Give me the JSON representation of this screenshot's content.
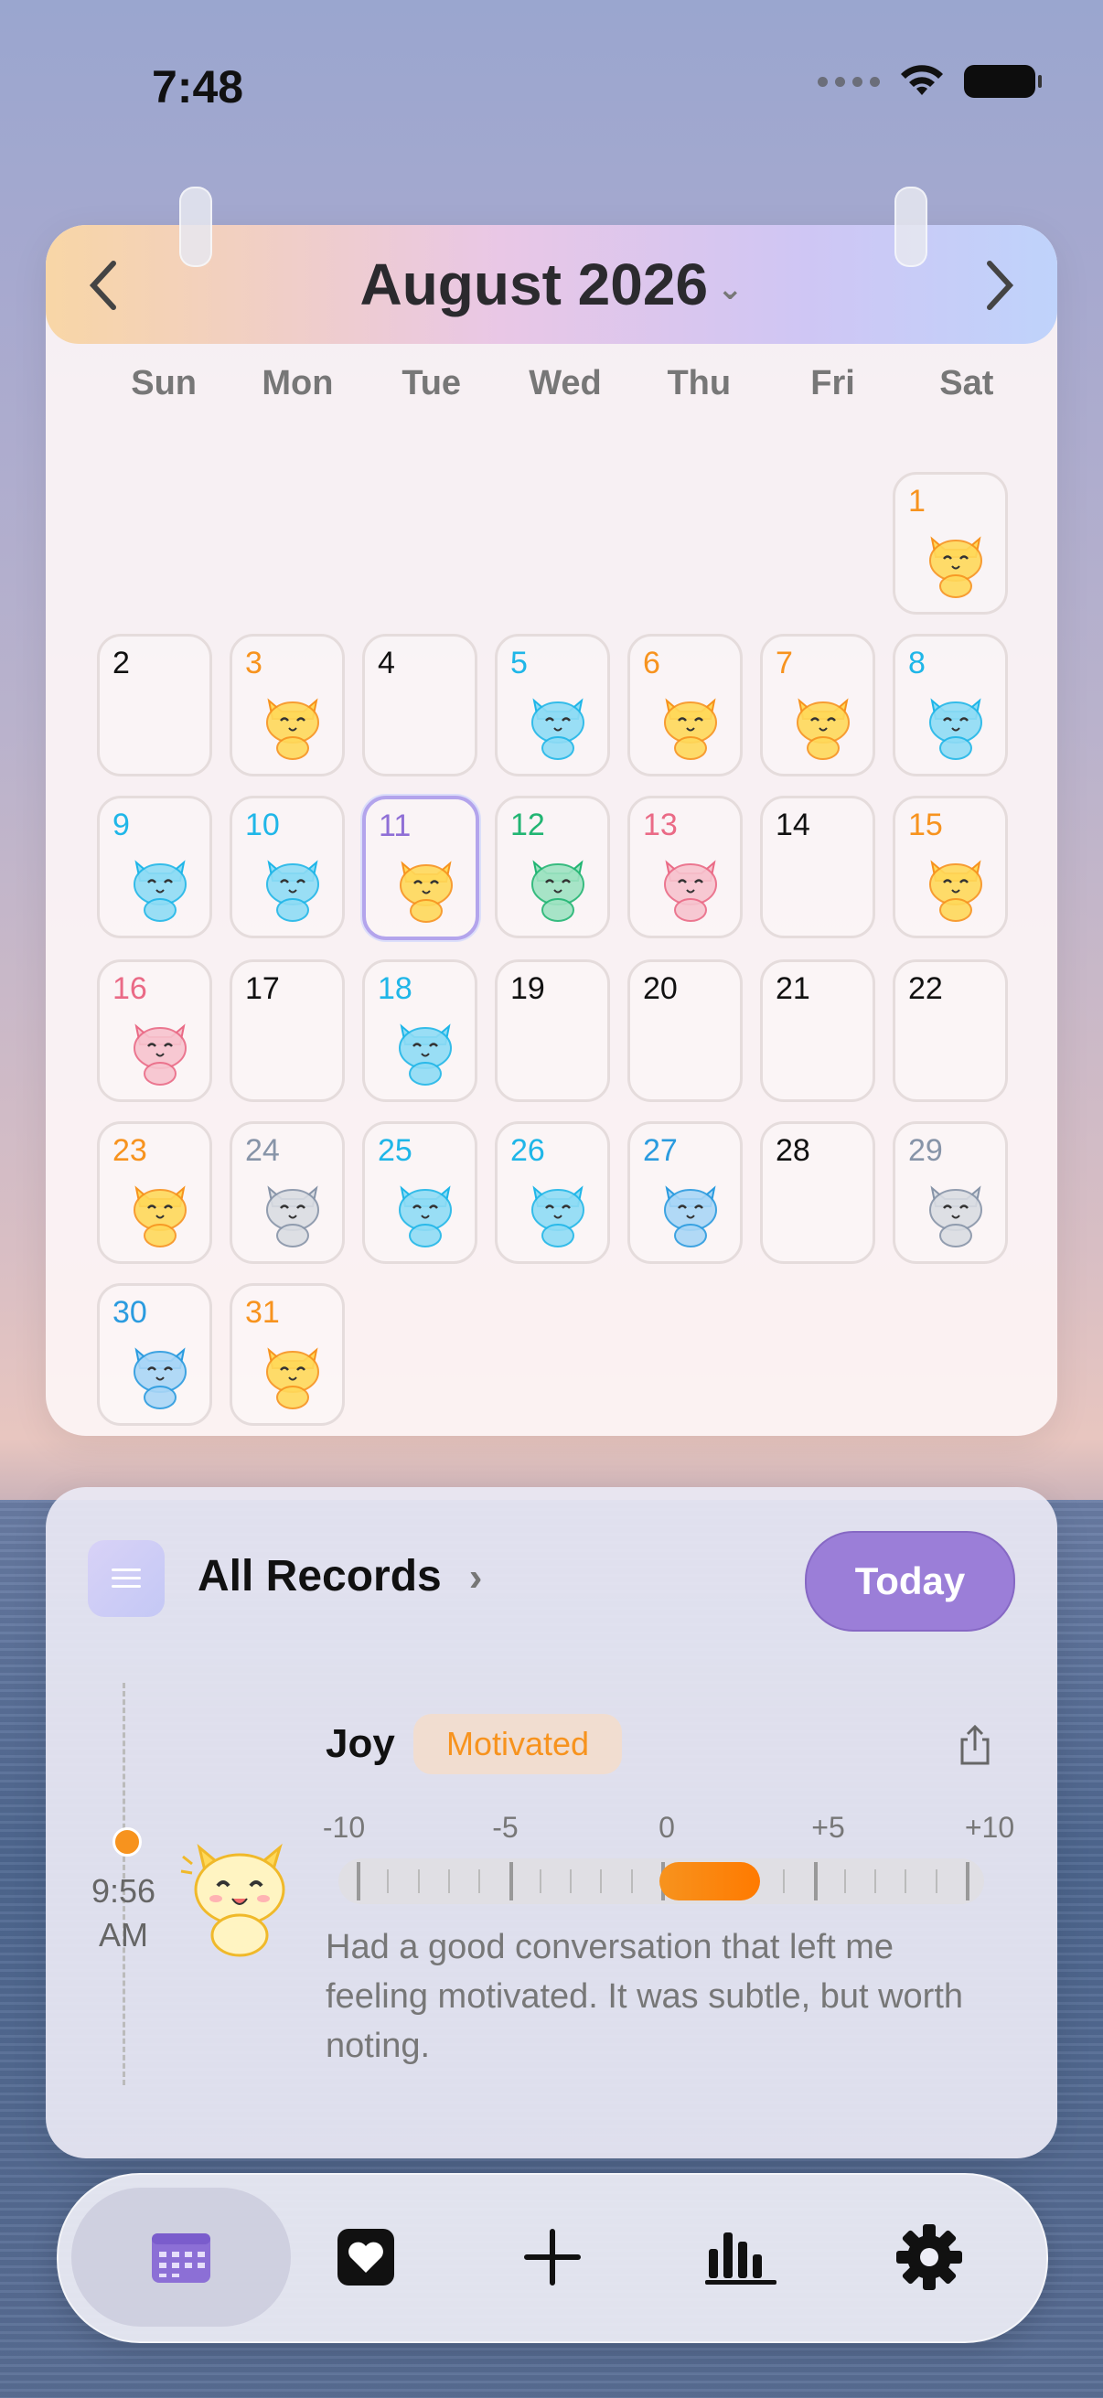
{
  "status": {
    "time": "7:48"
  },
  "calendar": {
    "title": "August 2026",
    "weekdays": [
      "Sun",
      "Mon",
      "Tue",
      "Wed",
      "Thu",
      "Fri",
      "Sat"
    ],
    "leading_blanks": 6,
    "today": 11,
    "days": [
      {
        "d": "1",
        "mood": "joy"
      },
      {
        "d": "2",
        "mood": ""
      },
      {
        "d": "3",
        "mood": "joy"
      },
      {
        "d": "4",
        "mood": ""
      },
      {
        "d": "5",
        "mood": "calm"
      },
      {
        "d": "6",
        "mood": "joy"
      },
      {
        "d": "7",
        "mood": "joy"
      },
      {
        "d": "8",
        "mood": "calm"
      },
      {
        "d": "9",
        "mood": "calm"
      },
      {
        "d": "10",
        "mood": "calm"
      },
      {
        "d": "11",
        "mood": "joy"
      },
      {
        "d": "12",
        "mood": "disgust"
      },
      {
        "d": "13",
        "mood": "fear"
      },
      {
        "d": "14",
        "mood": ""
      },
      {
        "d": "15",
        "mood": "joy"
      },
      {
        "d": "16",
        "mood": "fear"
      },
      {
        "d": "17",
        "mood": ""
      },
      {
        "d": "18",
        "mood": "calm"
      },
      {
        "d": "19",
        "mood": ""
      },
      {
        "d": "20",
        "mood": ""
      },
      {
        "d": "21",
        "mood": ""
      },
      {
        "d": "22",
        "mood": ""
      },
      {
        "d": "23",
        "mood": "joy"
      },
      {
        "d": "24",
        "mood": "tired"
      },
      {
        "d": "25",
        "mood": "calm"
      },
      {
        "d": "26",
        "mood": "calm"
      },
      {
        "d": "27",
        "mood": "sad"
      },
      {
        "d": "28",
        "mood": ""
      },
      {
        "d": "29",
        "mood": "tired"
      },
      {
        "d": "30",
        "mood": "sad"
      },
      {
        "d": "31",
        "mood": "joy"
      }
    ]
  },
  "mood_colors": {
    "joy": "#f7931e",
    "calm": "#1fb6e8",
    "disgust": "#22b573",
    "fear": "#ea6a86",
    "tired": "#8794a8",
    "sad": "#2a9bdf",
    "none": "#111111",
    "today": "#8f6fd6"
  },
  "cat_colors": {
    "joy": "#ffd95a",
    "calm": "#8fdcf5",
    "disgust": "#9fe3c2",
    "fear": "#f7c4cf",
    "tired": "#dadde3",
    "sad": "#a9d6f7"
  },
  "records": {
    "title": "All Records",
    "today_button": "Today",
    "entry": {
      "time": "9:56 AM",
      "emotion": "Joy",
      "tag": "Motivated",
      "scale_labels": [
        "-10",
        "-5",
        "0",
        "+5",
        "+10"
      ],
      "intensity": 3,
      "note": "Had a good conversation that left me feeling motivated. It was subtle, but worth noting."
    }
  },
  "tabs": [
    {
      "name": "calendar-icon"
    },
    {
      "name": "heart-icon"
    },
    {
      "name": "plus-icon"
    },
    {
      "name": "chart-icon"
    },
    {
      "name": "gear-icon"
    }
  ]
}
